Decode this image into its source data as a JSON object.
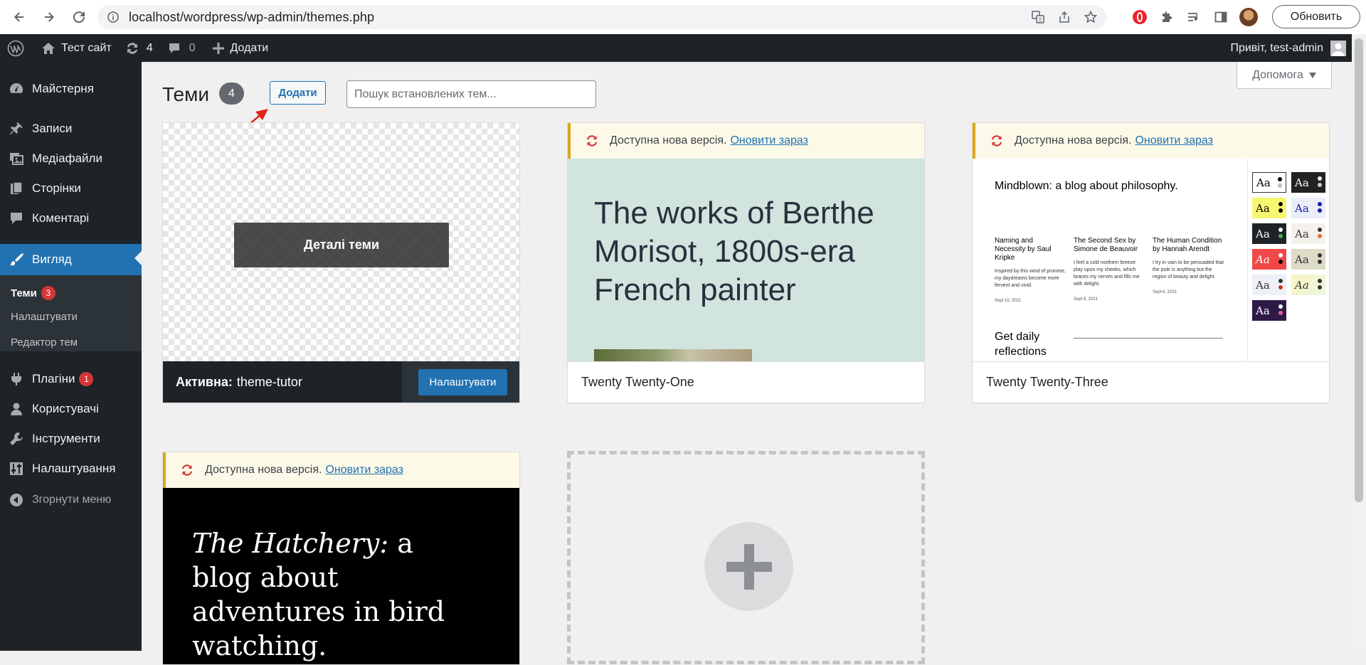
{
  "browser": {
    "url": "localhost/wordpress/wp-admin/themes.php",
    "update_button": "Обновить"
  },
  "adminbar": {
    "site_name": "Тест сайт",
    "updates_count": "4",
    "comments_count": "0",
    "new_label": "Додати",
    "greeting": "Привіт, test-admin"
  },
  "sidebar": {
    "items": [
      {
        "label": "Майстерня",
        "icon": "dashboard-icon"
      },
      {
        "label": "Записи",
        "icon": "pin-icon"
      },
      {
        "label": "Медіафайли",
        "icon": "media-icon"
      },
      {
        "label": "Сторінки",
        "icon": "pages-icon"
      },
      {
        "label": "Коментарі",
        "icon": "comment-icon"
      },
      {
        "label": "Вигляд",
        "icon": "brush-icon"
      },
      {
        "label": "Плагіни",
        "icon": "plugin-icon",
        "badge": "1"
      },
      {
        "label": "Користувачі",
        "icon": "users-icon"
      },
      {
        "label": "Інструменти",
        "icon": "wrench-icon"
      },
      {
        "label": "Налаштування",
        "icon": "settings-icon"
      },
      {
        "label": "Згорнути меню",
        "icon": "collapse-icon"
      }
    ],
    "submenu": [
      {
        "label": "Теми",
        "badge": "3"
      },
      {
        "label": "Налаштувати"
      },
      {
        "label": "Редактор тем"
      }
    ]
  },
  "main": {
    "title": "Теми",
    "count": "4",
    "add_button": "Додати",
    "search_placeholder": "Пошук встановлених тем...",
    "help_button": "Допомога",
    "update_notice": "Доступна нова версія.",
    "update_link": "Оновити зараз",
    "themes": [
      {
        "name": "theme-tutor",
        "active_label": "Активна:",
        "details_button": "Деталі теми",
        "customize_button": "Налаштувати"
      },
      {
        "name": "Twenty Twenty-One",
        "preview_headline": "The works of Berthe Morisot, 1800s-era French painter"
      },
      {
        "name": "Twenty Twenty-Three",
        "preview_title": "Mindblown: a blog about philosophy.",
        "preview_posts": [
          {
            "title": "Naming and Necessity by Saul Kripke",
            "excerpt": "Inspired by this wind of promise, my daydreams become more fervent and vivid.",
            "date": "Sept 10, 2021"
          },
          {
            "title": "The Second Sex by Simone de Beauvoir",
            "excerpt": "I feel a cold northern breeze play upon my cheeks, which braces my nerves and fills me with delight.",
            "date": "Sept 8, 2021"
          },
          {
            "title": "The Human Condition by Hannah Arendt",
            "excerpt": "I try in vain to be persuaded that the pole is anything but the region of beauty and delight.",
            "date": "Sept 6, 2021"
          }
        ],
        "preview_footer": "Get daily reflections",
        "swatch_label": "Aa"
      },
      {
        "name": "The Hatchery",
        "preview_italic": "The Hatchery:",
        "preview_rest": " a blog about adventures in bird watching."
      }
    ]
  },
  "colors": {
    "wp_dark": "#1d2327",
    "wp_blue": "#2271b1",
    "badge_red": "#d63638",
    "notice_yellow": "#dba617",
    "tt1_bg": "#d1e4dd"
  }
}
